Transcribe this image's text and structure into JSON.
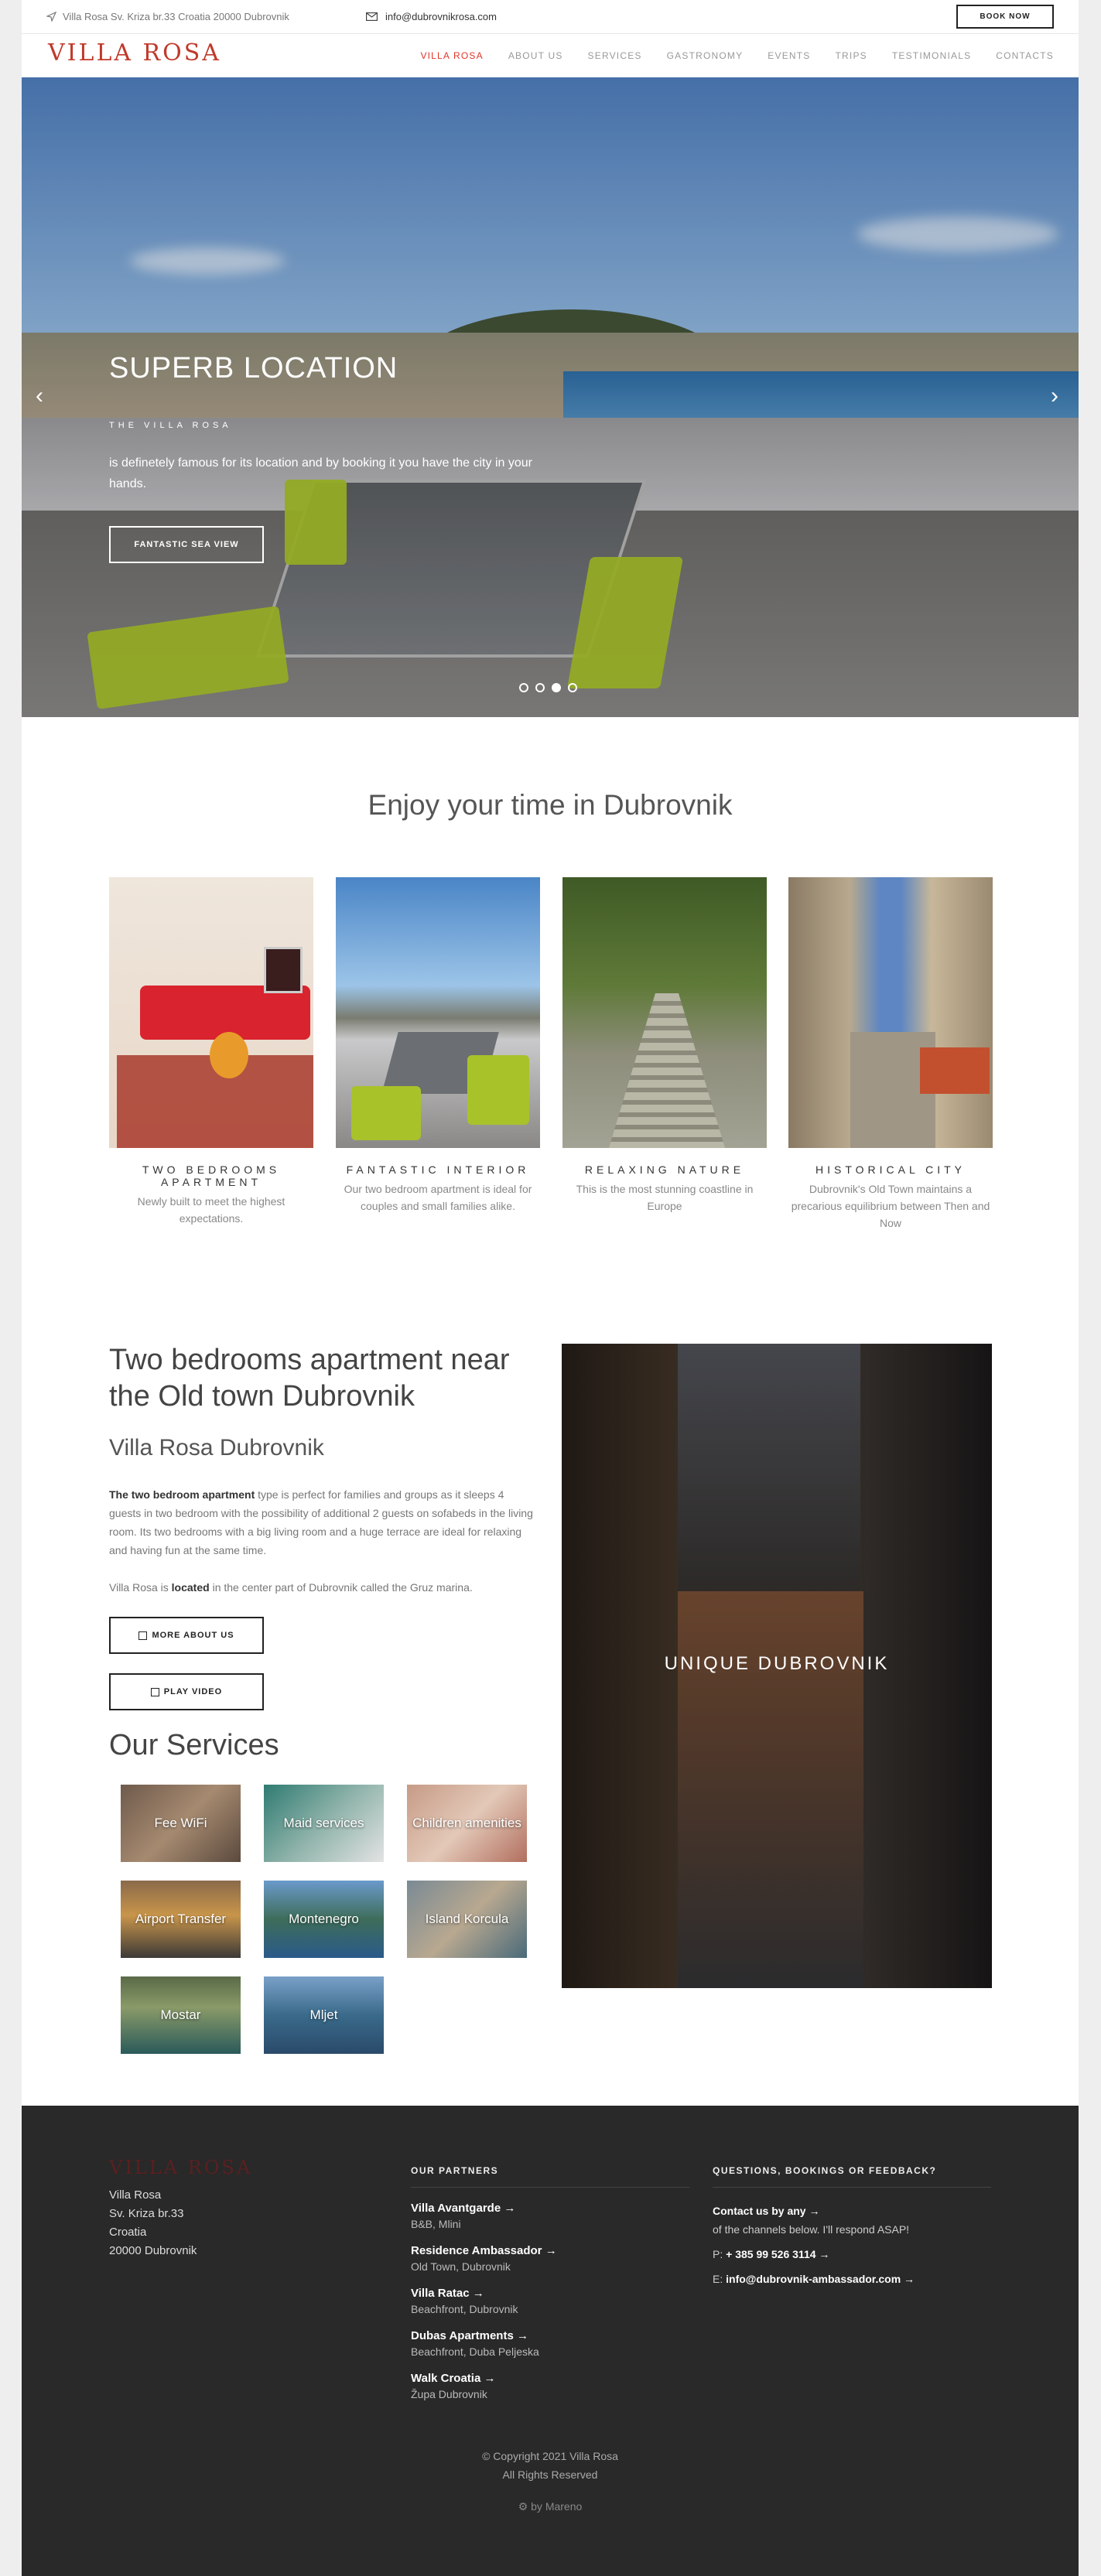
{
  "topbar": {
    "address": "Villa Rosa Sv. Kriza br.33 Croatia 20000 Dubrovnik",
    "email": "info@dubrovnikrosa.com",
    "book_now": "BOOK NOW"
  },
  "nav": {
    "logo": "VILLA ROSA",
    "items": [
      "VILLA ROSA",
      "ABOUT US",
      "SERVICES",
      "GASTRONOMY",
      "EVENTS",
      "TRIPS",
      "TESTIMONIALS",
      "CONTACTS"
    ]
  },
  "hero": {
    "title": "SUPERB LOCATION",
    "subtitle": "THE VILLA ROSA",
    "description": "is definetely famous for its location and by booking it you have the city in your hands.",
    "cta": "FANTASTIC SEA VIEW",
    "slide_count": 4,
    "active_slide": 3
  },
  "enjoy": {
    "title": "Enjoy your time in Dubrovnik",
    "features": [
      {
        "title": "TWO BEDROOMS APARTMENT",
        "text": "Newly built to meet the highest expectations."
      },
      {
        "title": "FANTASTIC INTERIOR",
        "text": "Our two bedroom apartment is ideal for couples and small families alike."
      },
      {
        "title": "RELAXING NATURE",
        "text": "This is the most stunning coastline in Europe"
      },
      {
        "title": "HISTORICAL CITY",
        "text": "Dubrovnik's Old Town maintains a precarious equilibrium between Then and Now"
      }
    ]
  },
  "about": {
    "heading": "Two bedrooms apartment near the Old town Dubrovnik",
    "subheading": "Villa Rosa Dubrovnik",
    "p1_bold": "The two bedroom apartment",
    "p1_rest": " type is perfect for families and groups as it sleeps 4 guests in two bedroom with the possibility of additional 2 guests on sofabeds in the living room. Its two bedrooms with a big living room and a huge terrace are ideal for relaxing and having fun at the same time.",
    "p2_pre": "Villa Rosa is ",
    "p2_bold": "located",
    "p2_post": " in the center part of Dubrovnik called the Gruz marina.",
    "more_button": "MORE ABOUT US",
    "video_button": "PLAY VIDEO",
    "image_label": "UNIQUE DUBROVNIK"
  },
  "services": {
    "title": "Our Services",
    "items": [
      "Fee WiFi",
      "Maid services",
      "Children amenities",
      "Airport Transfer",
      "Montenegro",
      "Island Korcula",
      "Mostar",
      "Mljet"
    ]
  },
  "footer": {
    "logo": "VILLA ROSA",
    "address": [
      "Villa Rosa",
      "Sv. Kriza br.33",
      "Croatia",
      "20000 Dubrovnik"
    ],
    "partners_title": "OUR PARTNERS",
    "partners": [
      {
        "name": "Villa Avantgarde",
        "location": "B&B, Mlini"
      },
      {
        "name": "Residence Ambassador",
        "location": "Old Town, Dubrovnik"
      },
      {
        "name": "Villa Ratac",
        "location": "Beachfront, Dubrovnik"
      },
      {
        "name": "Dubas Apartments",
        "location": "Beachfront, Duba Peljeska"
      },
      {
        "name": "Walk Croatia",
        "location": "Župa Dubrovnik"
      }
    ],
    "contact_title": "QUESTIONS, BOOKINGS OR FEEDBACK?",
    "contact_link": "Contact us by any",
    "contact_text": "of the channels below. I'll respond ASAP!",
    "phone_label": "P:",
    "phone": "+ 385 99 526 3114",
    "email_label": "E:",
    "email": "info@dubrovnik-ambassador.com",
    "copyright": "© Copyright 2021 Villa Rosa",
    "rights": "All Rights Reserved",
    "byline": "by Mareno"
  }
}
